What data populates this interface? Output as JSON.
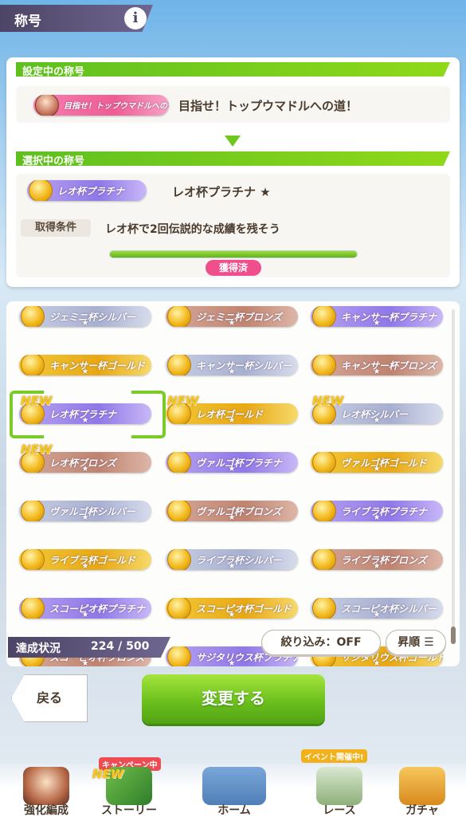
{
  "header": {
    "title": "称号",
    "info_icon": "i"
  },
  "current": {
    "section_label": "設定中の称号",
    "badge_text": "目指せ！トップウマドルへの道！",
    "title": "目指せ！トップウマドルへの道！"
  },
  "selected": {
    "section_label": "選択中の称号",
    "badge_text": "レオ杯プラチナ",
    "title": "レオ杯プラチナ ★",
    "condition_label": "取得条件",
    "condition_text": "レオ杯で2回伝説的な成績を残そう",
    "progress": 1.0,
    "status": "獲得済"
  },
  "list": {
    "new_label": "NEW",
    "rows": [
      [
        {
          "text": "ジェミニ杯シルバー",
          "tier": "silver"
        },
        {
          "text": "ジェミニ杯ブロンズ",
          "tier": "bronze"
        },
        {
          "text": "キャンサー杯プラチナ",
          "tier": "plat"
        }
      ],
      [
        {
          "text": "キャンサー杯ゴールド",
          "tier": "gold"
        },
        {
          "text": "キャンサー杯シルバー",
          "tier": "silver"
        },
        {
          "text": "キャンサー杯ブロンズ",
          "tier": "bronze"
        }
      ],
      [
        {
          "text": "レオ杯プラチナ",
          "tier": "plat"
        },
        {
          "text": "レオ杯ゴールド",
          "tier": "gold"
        },
        {
          "text": "レオ杯シルバー",
          "tier": "silver"
        }
      ],
      [
        {
          "text": "レオ杯ブロンズ",
          "tier": "bronze"
        },
        {
          "text": "ヴァルゴ杯プラチナ",
          "tier": "plat"
        },
        {
          "text": "ヴァルゴ杯ゴールド",
          "tier": "gold"
        }
      ],
      [
        {
          "text": "ヴァルゴ杯シルバー",
          "tier": "silver"
        },
        {
          "text": "ヴァルゴ杯ブロンズ",
          "tier": "bronze"
        },
        {
          "text": "ライブラ杯プラチナ",
          "tier": "plat"
        }
      ],
      [
        {
          "text": "ライブラ杯ゴールド",
          "tier": "gold"
        },
        {
          "text": "ライブラ杯シルバー",
          "tier": "silver"
        },
        {
          "text": "ライブラ杯ブロンズ",
          "tier": "bronze"
        }
      ],
      [
        {
          "text": "スコーピオ杯プラチナ",
          "tier": "plat"
        },
        {
          "text": "スコーピオ杯ゴールド",
          "tier": "gold"
        },
        {
          "text": "スコーピオ杯シルバー",
          "tier": "silver"
        }
      ],
      [
        {
          "text": "スコーピオ杯ブロンズ",
          "tier": "bronze"
        },
        {
          "text": "サジタリウス杯プラチナ",
          "tier": "plat"
        },
        {
          "text": "サジタリウス杯ゴールド",
          "tier": "gold"
        }
      ]
    ]
  },
  "status": {
    "label": "達成状況",
    "value": "224 / 500"
  },
  "filter": {
    "label": "絞り込み：OFF"
  },
  "sort": {
    "label": "昇順"
  },
  "buttons": {
    "back": "戻る",
    "change": "変更する"
  },
  "nav": {
    "items": [
      {
        "label": "強化編成"
      },
      {
        "label": "ストーリー",
        "badge": "キャンペーン中",
        "new": "NEW"
      },
      {
        "label": "ホーム"
      },
      {
        "label": "レース",
        "badge": "イベント開催中!"
      },
      {
        "label": "ガチャ"
      }
    ]
  },
  "colors": {
    "accent_green": "#6cc01d",
    "header_purple": "#4d4566",
    "pink": "#ef4f8c"
  }
}
